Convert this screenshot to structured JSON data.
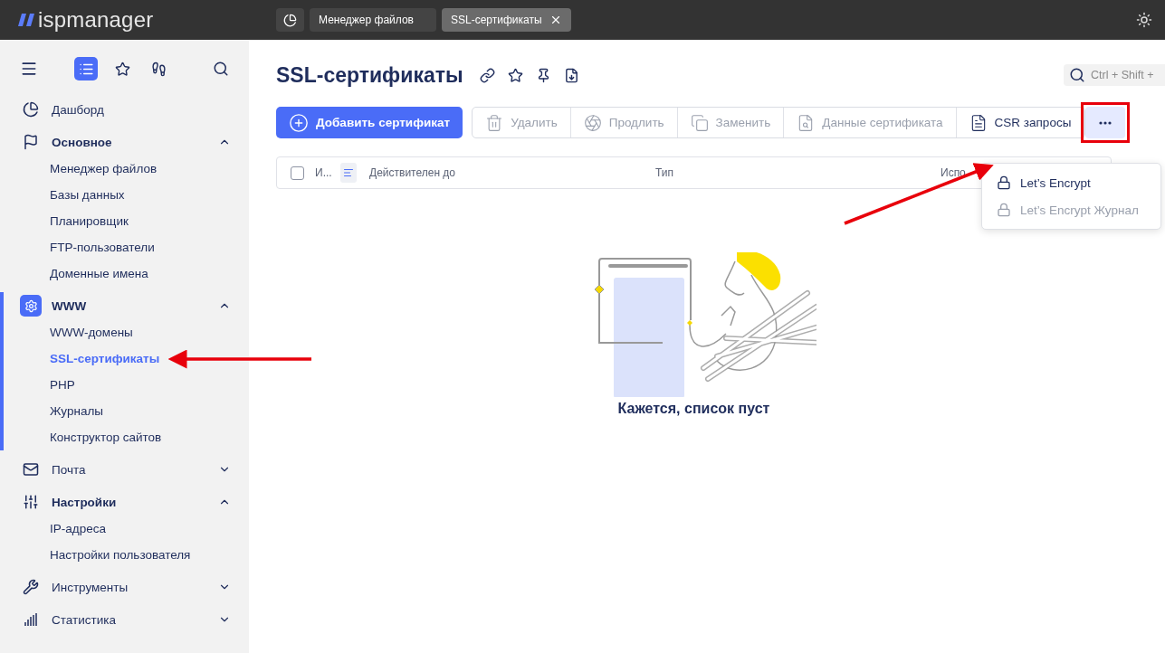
{
  "topbar": {
    "logo": "ispmanager",
    "tabs": [
      {
        "kind": "icon",
        "selected": false
      },
      {
        "kind": "text",
        "label": "Менеджер файлов",
        "selected": false
      },
      {
        "kind": "text",
        "label": "SSL-сертификаты",
        "selected": true,
        "closable": true
      }
    ]
  },
  "sidebar": {
    "modes": [
      {
        "selected": true
      },
      {
        "selected": false
      },
      {
        "selected": false
      }
    ],
    "items": [
      {
        "kind": "link",
        "label": "Дашборд"
      },
      {
        "kind": "group",
        "label": "Основное",
        "expanded": true,
        "active": false,
        "children": [
          {
            "label": "Менеджер файлов",
            "selected": false
          },
          {
            "label": "Базы данных",
            "selected": false
          },
          {
            "label": "Планировщик",
            "selected": false
          },
          {
            "label": "FTP-пользователи",
            "selected": false
          },
          {
            "label": "Доменные имена",
            "selected": false
          }
        ]
      },
      {
        "kind": "group",
        "label": "WWW",
        "expanded": true,
        "active": true,
        "children": [
          {
            "label": "WWW-домены",
            "selected": false
          },
          {
            "label": "SSL-сертификаты",
            "selected": true,
            "pointed": true
          },
          {
            "label": "PHP",
            "selected": false
          },
          {
            "label": "Журналы",
            "selected": false
          },
          {
            "label": "Конструктор сайтов",
            "selected": false
          }
        ]
      },
      {
        "kind": "group",
        "label": "Почта",
        "expanded": false,
        "active": false
      },
      {
        "kind": "group",
        "label": "Настройки",
        "expanded": true,
        "active": false,
        "children": [
          {
            "label": "IP-адреса",
            "selected": false
          },
          {
            "label": "Настройки пользователя",
            "selected": false
          }
        ]
      },
      {
        "kind": "group",
        "label": "Инструменты",
        "expanded": false,
        "active": false
      },
      {
        "kind": "group",
        "label": "Статистика",
        "expanded": false,
        "active": false
      }
    ]
  },
  "page": {
    "title": "SSL-сертификаты",
    "search": {
      "placeholder": "Ctrl + Shift +"
    },
    "add_button": "Добавить сертификат",
    "actions": [
      {
        "label": "Удалить",
        "disabled": true
      },
      {
        "label": "Продлить",
        "disabled": true
      },
      {
        "label": "Заменить",
        "disabled": true
      },
      {
        "label": "Данные сертификата",
        "disabled": true
      },
      {
        "label": "CSR запросы",
        "disabled": false
      }
    ],
    "more_button": {
      "highlighted": true
    },
    "menu": [
      {
        "label": "Let’s Encrypt",
        "disabled": false,
        "pointed": true
      },
      {
        "label": "Let’s Encrypt Журнал",
        "disabled": true,
        "pointed": false
      }
    ],
    "table": {
      "all_checked": false,
      "columns": [
        "И...",
        "Действителен до",
        "Тип",
        "Испо"
      ]
    },
    "empty_text": "Кажется, список пуст"
  }
}
